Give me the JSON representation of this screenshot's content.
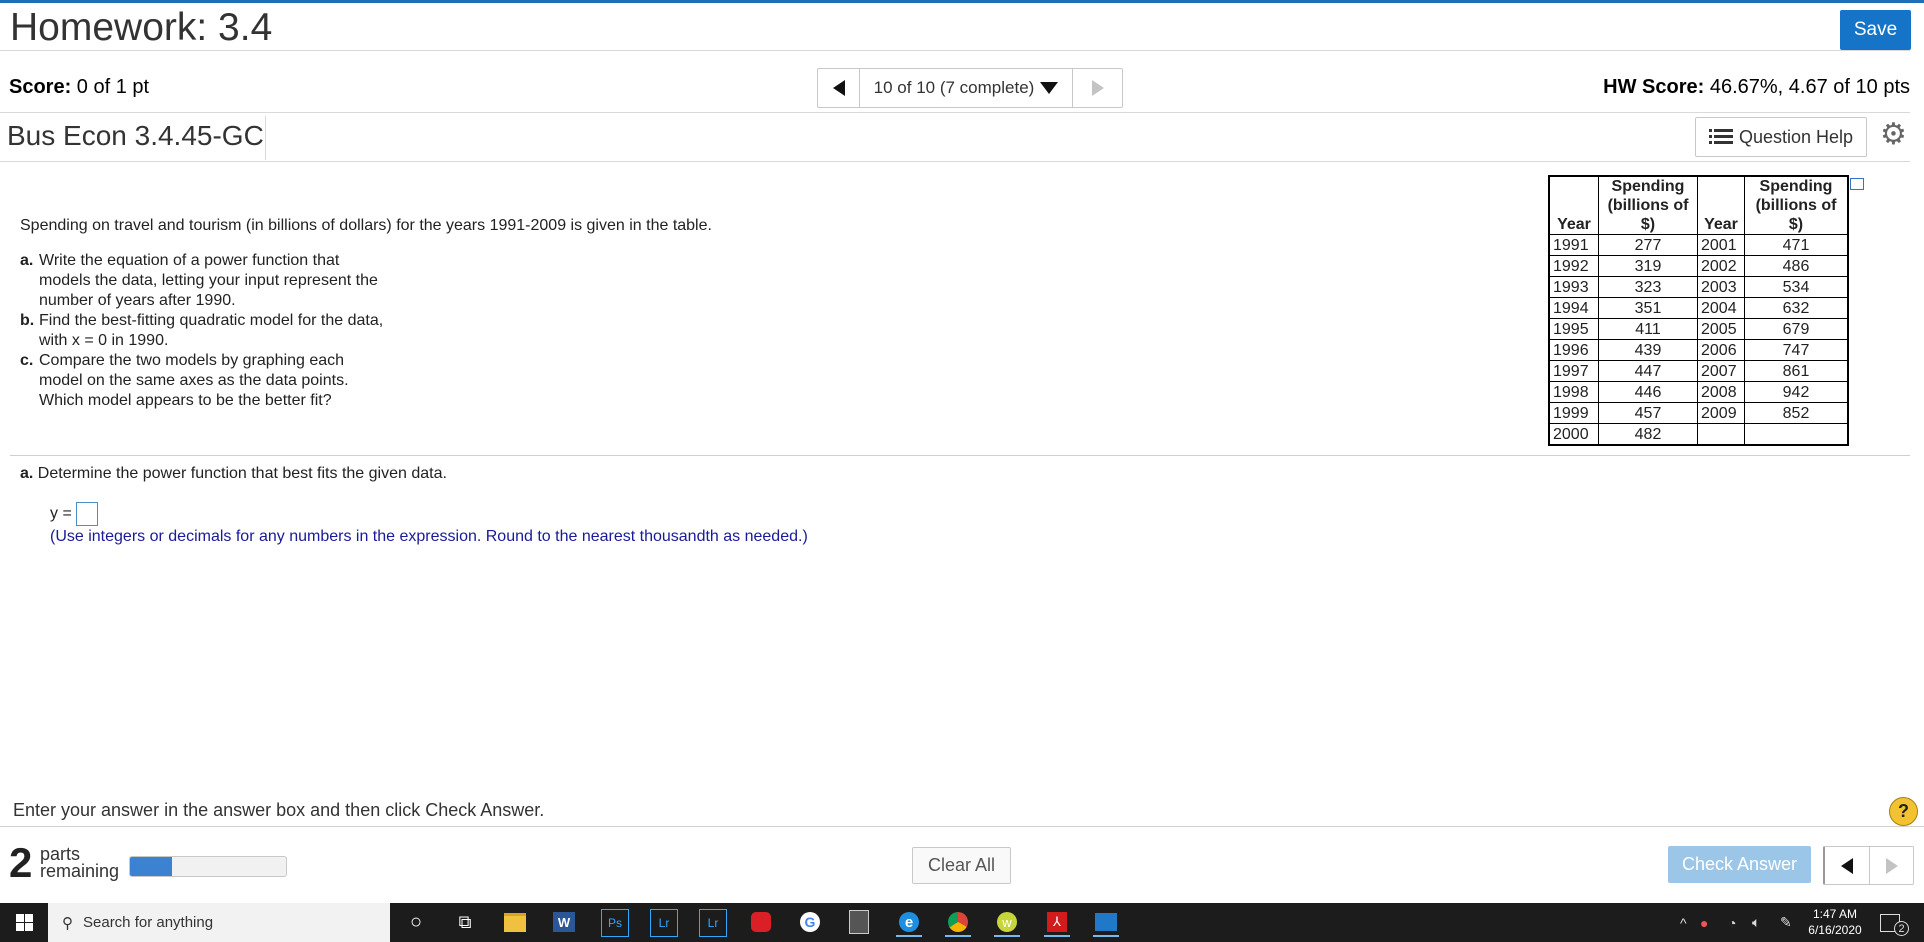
{
  "header": {
    "title": "Homework: 3.4",
    "save_label": "Save",
    "score_label": "Score:",
    "score_value": " 0 of 1 pt",
    "nav_label": "10 of 10 (7 complete)",
    "hw_score_label": "HW Score:",
    "hw_score_value": " 46.67%, 4.67 of 10 pts",
    "question_id": "Bus Econ 3.4.45-GC",
    "question_help_label": "Question Help"
  },
  "problem": {
    "statement": "Spending on travel and tourism (in billions of dollars) for the years 1991-2009 is given in the table.",
    "parts": [
      {
        "letter": "a.",
        "text": "Write the equation of a power function that models the data, letting your input represent the number of years after 1990."
      },
      {
        "letter": "b.",
        "text": "Find the best-fitting quadratic model for the data, with x = 0 in 1990."
      },
      {
        "letter": "c.",
        "text": "Compare the two models by graphing each model on the same axes as the data points. Which model appears to be the better fit?"
      }
    ]
  },
  "table": {
    "headers": [
      "Year",
      "Spending (billions of $)",
      "Year",
      "Spending (billions of $)"
    ],
    "rows": [
      [
        "1991",
        "277",
        "2001",
        "471"
      ],
      [
        "1992",
        "319",
        "2002",
        "486"
      ],
      [
        "1993",
        "323",
        "2003",
        "534"
      ],
      [
        "1994",
        "351",
        "2004",
        "632"
      ],
      [
        "1995",
        "411",
        "2005",
        "679"
      ],
      [
        "1996",
        "439",
        "2006",
        "747"
      ],
      [
        "1997",
        "447",
        "2007",
        "861"
      ],
      [
        "1998",
        "446",
        "2008",
        "942"
      ],
      [
        "1999",
        "457",
        "2009",
        "852"
      ],
      [
        "2000",
        "482",
        "",
        ""
      ]
    ]
  },
  "answer": {
    "part_letter": "a.",
    "part_prompt": " Determine the power function that best fits the given data.",
    "y_label": "y =",
    "input_value": "",
    "hint": "(Use integers or decimals for any numbers in the expression. Round to the nearest thousandth as needed.)"
  },
  "footer": {
    "instruction": "Enter your answer in the answer box and then click Check Answer.",
    "help_symbol": "?",
    "parts_remaining_count": "2",
    "parts_word": "parts",
    "remaining_word": "remaining",
    "progress_fraction": 0.27,
    "clear_all_label": "Clear All",
    "check_answer_label": "Check Answer"
  },
  "taskbar": {
    "search_placeholder": "Search for anything",
    "time": "1:47 AM",
    "date": "6/16/2020",
    "notification_count": "2",
    "apps": [
      "cortana-icon",
      "task-view-icon",
      "file-explorer-icon",
      "word-icon",
      "photoshop-icon",
      "lightroom-icon",
      "lightroom-classic-icon",
      "creative-cloud-icon",
      "google-icon",
      "calculator-icon",
      "edge-icon",
      "chrome-icon",
      "wondershare-icon",
      "acrobat-icon",
      "photos-icon"
    ]
  },
  "colors": {
    "accent": "#1574c8",
    "check_answer_disabled": "#9bc6e8",
    "hint_text": "#1a1a9a",
    "progress_fill": "#3b82d1"
  }
}
